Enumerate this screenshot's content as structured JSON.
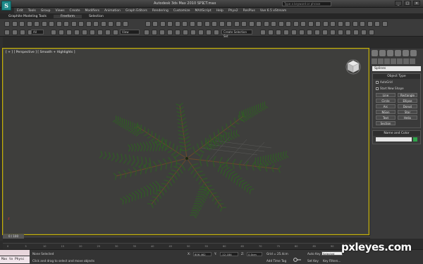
{
  "app": {
    "logo_letter": "S",
    "title": "Autodesk 3ds Max 2010 SP1",
    "filename": "CT.max",
    "search_placeholder": "Type a keyword or phrase",
    "window_controls": [
      "_",
      "□",
      "×"
    ]
  },
  "menu": [
    "Edit",
    "Tools",
    "Group",
    "Views",
    "Create",
    "Modifiers",
    "Animation",
    "Graph Editors",
    "Rendering",
    "Customize",
    "MAXScript",
    "Help",
    "Phyx2",
    "ResPlus",
    "Vue 6.5 xStream"
  ],
  "ribbon": {
    "tabs": [
      "Graphite Modeling Tools",
      "Freeform",
      "Selection"
    ],
    "active_tab": "Freeform"
  },
  "toolbar": {
    "selection_filter": "All",
    "reference_coord": "View",
    "named_selection": "Create Selection Set"
  },
  "viewport": {
    "label": "[ + ] [ Perspective ] [ Smooth + Highlights ]",
    "axis": "z",
    "accent_color": "#c8b000"
  },
  "command_panel": {
    "category_dropdown": "Splines",
    "object_type_title": "Object Type",
    "autogrid_label": "AutoGrid",
    "start_new_shape_label": "Start New Shape",
    "buttons": [
      "Line",
      "Rectangle",
      "Circle",
      "Ellipse",
      "Arc",
      "Donut",
      "NGon",
      "Star",
      "Text",
      "Helix",
      "Section",
      ""
    ],
    "name_color_title": "Name and Color",
    "object_color": "#2fa34a"
  },
  "timeline": {
    "current_frame": "0 / 100",
    "ticks": [
      "0",
      "5",
      "10",
      "15",
      "20",
      "25",
      "30",
      "35",
      "40",
      "45",
      "50",
      "55",
      "60",
      "65",
      "70",
      "75",
      "80",
      "85",
      "90",
      "95",
      "100"
    ]
  },
  "status": {
    "maxscript": "Max to Physc",
    "selection_status": "None Selected",
    "prompt": "Click and drag to select and move objects",
    "x_label": "X:",
    "x_value": "806.462",
    "y_label": "Y:",
    "y_value": "-12.184",
    "z_label": "Z:",
    "z_value": "0.0cm",
    "grid": "Grid = 25.4cm",
    "auto_key": "Auto Key",
    "selected_dropdown": "Selected",
    "set_key": "Set Key",
    "key_filters": "Key Filters...",
    "add_time_tag": "Add Time Tag"
  },
  "watermark": "pxleyes.com"
}
